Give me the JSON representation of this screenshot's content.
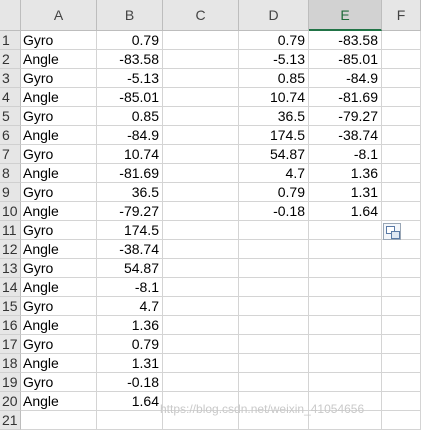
{
  "columns": [
    "A",
    "B",
    "C",
    "D",
    "E",
    "F"
  ],
  "selected_column": "E",
  "rows": [
    {
      "n": "1",
      "a": "Gyro",
      "b": "0.79",
      "d": "0.79",
      "e": "-83.58"
    },
    {
      "n": "2",
      "a": "Angle",
      "b": "-83.58",
      "d": "-5.13",
      "e": "-85.01"
    },
    {
      "n": "3",
      "a": "Gyro",
      "b": "-5.13",
      "d": "0.85",
      "e": "-84.9"
    },
    {
      "n": "4",
      "a": "Angle",
      "b": "-85.01",
      "d": "10.74",
      "e": "-81.69"
    },
    {
      "n": "5",
      "a": "Gyro",
      "b": "0.85",
      "d": "36.5",
      "e": "-79.27"
    },
    {
      "n": "6",
      "a": "Angle",
      "b": "-84.9",
      "d": "174.5",
      "e": "-38.74"
    },
    {
      "n": "7",
      "a": "Gyro",
      "b": "10.74",
      "d": "54.87",
      "e": "-8.1"
    },
    {
      "n": "8",
      "a": "Angle",
      "b": "-81.69",
      "d": "4.7",
      "e": "1.36"
    },
    {
      "n": "9",
      "a": "Gyro",
      "b": "36.5",
      "d": "0.79",
      "e": "1.31"
    },
    {
      "n": "10",
      "a": "Angle",
      "b": "-79.27",
      "d": "-0.18",
      "e": "1.64"
    },
    {
      "n": "11",
      "a": "Gyro",
      "b": "174.5",
      "d": "",
      "e": ""
    },
    {
      "n": "12",
      "a": "Angle",
      "b": "-38.74",
      "d": "",
      "e": ""
    },
    {
      "n": "13",
      "a": "Gyro",
      "b": "54.87",
      "d": "",
      "e": ""
    },
    {
      "n": "14",
      "a": "Angle",
      "b": "-8.1",
      "d": "",
      "e": ""
    },
    {
      "n": "15",
      "a": "Gyro",
      "b": "4.7",
      "d": "",
      "e": ""
    },
    {
      "n": "16",
      "a": "Angle",
      "b": "1.36",
      "d": "",
      "e": ""
    },
    {
      "n": "17",
      "a": "Gyro",
      "b": "0.79",
      "d": "",
      "e": ""
    },
    {
      "n": "18",
      "a": "Angle",
      "b": "1.31",
      "d": "",
      "e": ""
    },
    {
      "n": "19",
      "a": "Gyro",
      "b": "-0.18",
      "d": "",
      "e": ""
    },
    {
      "n": "20",
      "a": "Angle",
      "b": "1.64",
      "d": "",
      "e": ""
    },
    {
      "n": "21",
      "a": "",
      "b": "",
      "d": "",
      "e": ""
    }
  ],
  "paste_options_icon": "paste-options-icon",
  "watermark": "https://blog.csdn.net/weixin_41054656",
  "colors": {
    "selected_header_text": "#1e6b3a",
    "selected_header_bar": "#217346"
  }
}
